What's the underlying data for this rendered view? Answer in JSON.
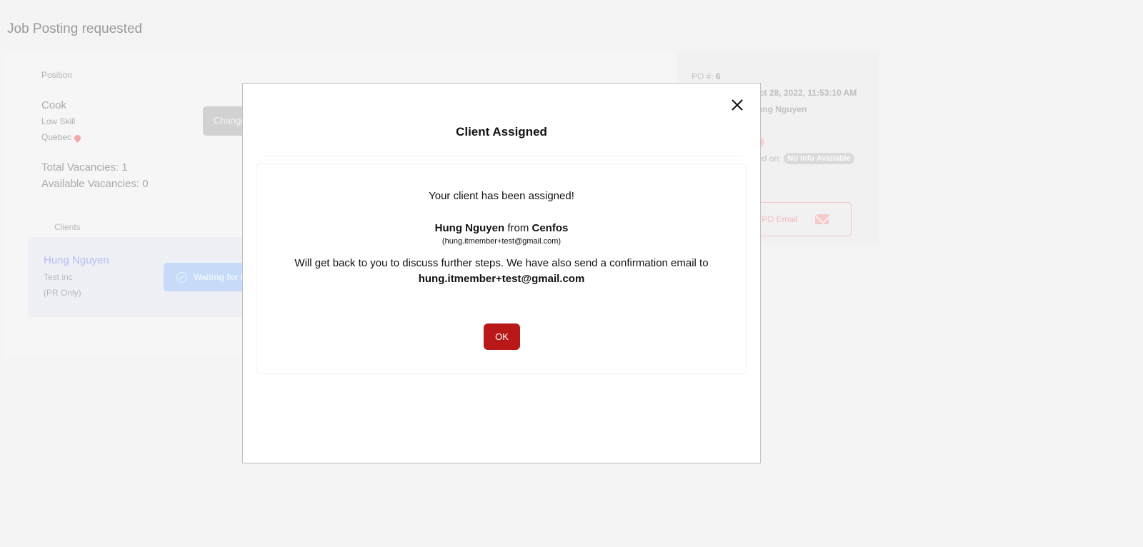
{
  "page": {
    "title": "Job Posting requested"
  },
  "position": {
    "label": "Position",
    "title": "Cook",
    "skill": "Low Skill",
    "location": "Quebec",
    "change_label": "Change",
    "total_vacancies": "Total Vacancies: 1",
    "available_vacancies": "Available Vacancies: 0"
  },
  "clients": {
    "label": "Clients",
    "items": [
      {
        "name": "Hung Nguyen",
        "company": "Test inc",
        "note": "(PR Only)",
        "status": "Waiting for I"
      }
    ]
  },
  "po": {
    "number_label": "PO #:",
    "number_value": "6",
    "date": "ct 28, 2022, 11:53:10 AM",
    "owner": "ung Nguyen",
    "shared_label": "ed on:",
    "shared_value": "No Info Available",
    "email_button": "PO Email"
  },
  "modal": {
    "title": "Client Assigned",
    "message": "Your client has been assigned!",
    "client_name": "Hung Nguyen",
    "from_word": "from",
    "company": "Cenfos",
    "client_email_paren": "(hung.itmember+test@gmail.com)",
    "followup": "Will get back to you to discuss further steps. We have also send a confirmation email to",
    "confirmation_email": "hung.itmember+test@gmail.com",
    "ok_label": "OK"
  },
  "colors": {
    "accent_red": "#b81818",
    "client_name": "#b6bdf1",
    "status_badge": "#c5dbf8"
  }
}
